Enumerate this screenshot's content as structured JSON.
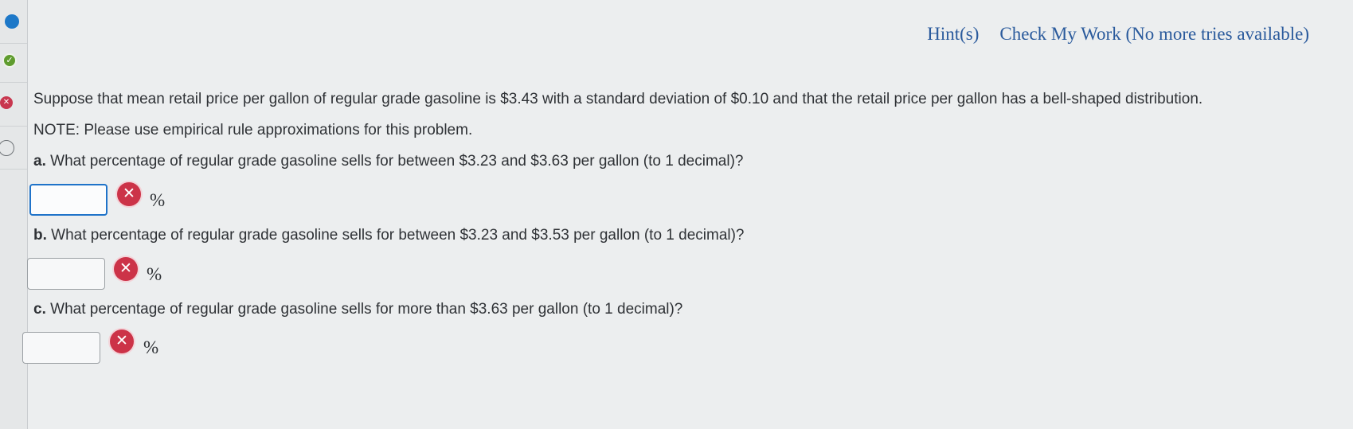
{
  "toolbar": {
    "hints_label": "Hint(s)",
    "check_label": "Check My Work (No more tries available)"
  },
  "progress": {
    "icons": [
      "current",
      "correct",
      "incorrect",
      "unanswered"
    ]
  },
  "colors": {
    "link": "#2a5a9c",
    "error": "#cc3348",
    "correct": "#5f9c2e",
    "current": "#1d78c8"
  },
  "question": {
    "stem": "Suppose that mean retail price per gallon of regular grade gasoline is $3.43 with a standard deviation of $0.10 and that the retail price per gallon has a bell-shaped distribution.",
    "note": "NOTE: Please use empirical rule approximations for this problem.",
    "parts": [
      {
        "letter": "a.",
        "text": "What percentage of regular grade gasoline sells for between $3.23 and $3.63 per gallon (to 1 decimal)?",
        "value": "",
        "unit": "%",
        "status": "incorrect"
      },
      {
        "letter": "b.",
        "text": "What percentage of regular grade gasoline sells for between $3.23 and $3.53 per gallon (to 1 decimal)?",
        "value": "",
        "unit": "%",
        "status": "incorrect"
      },
      {
        "letter": "c.",
        "text": "What percentage of regular grade gasoline sells for more than $3.63 per gallon (to 1 decimal)?",
        "value": "",
        "unit": "%",
        "status": "incorrect"
      }
    ]
  }
}
